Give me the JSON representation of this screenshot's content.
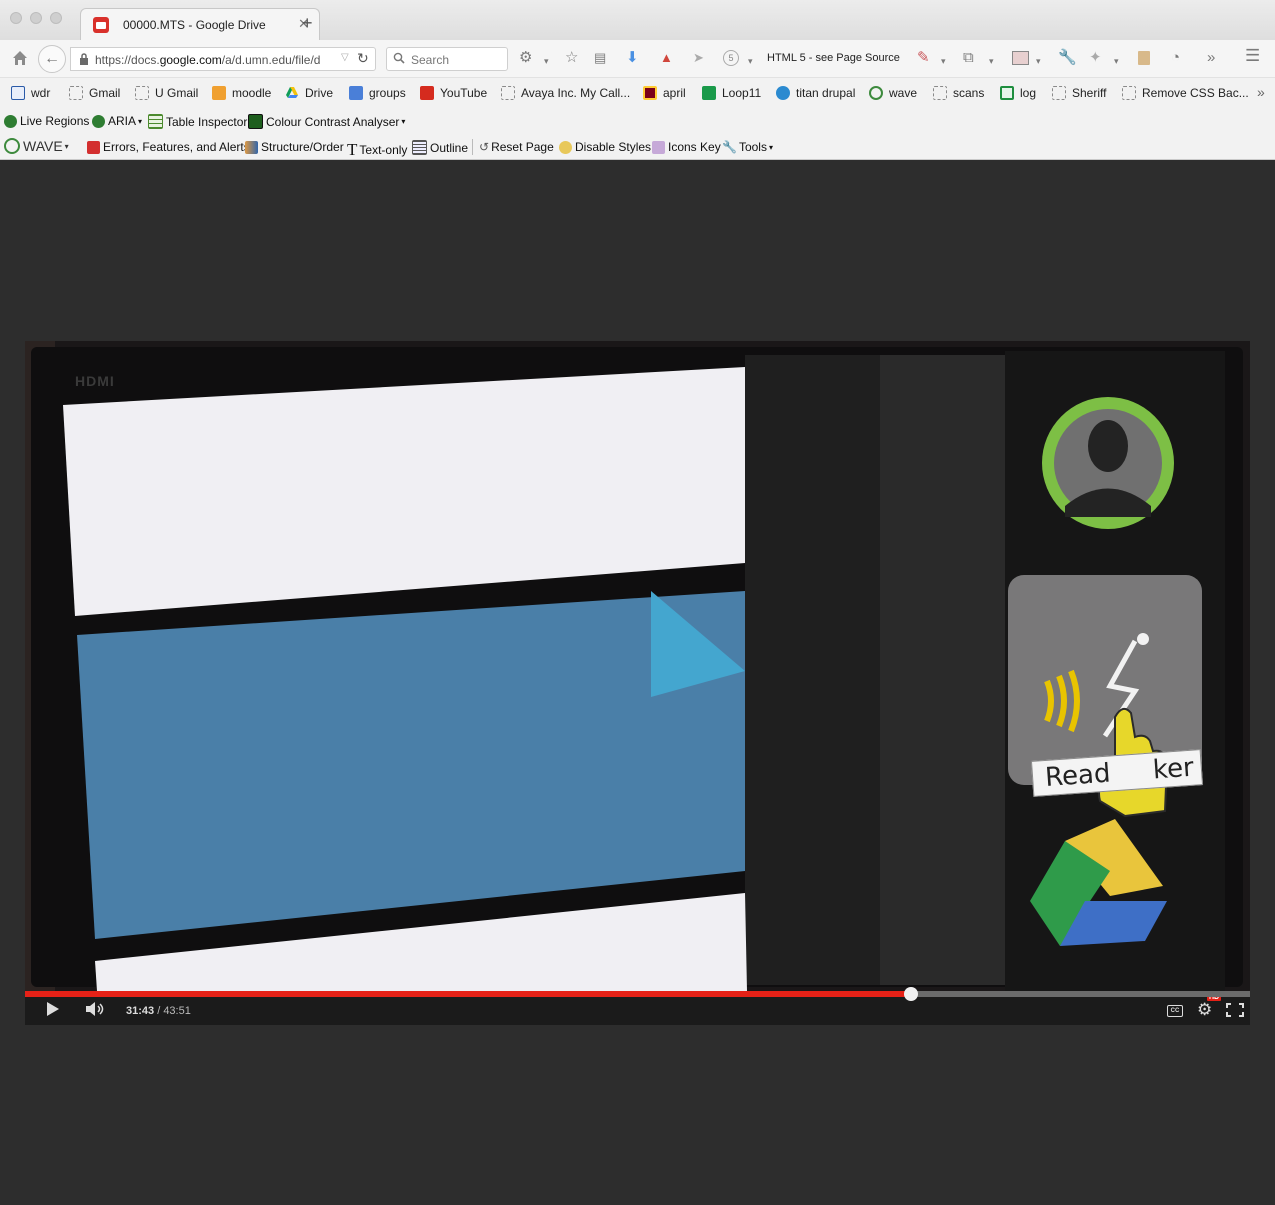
{
  "window": {
    "tab_title": "00000.MTS - Google Drive",
    "tab_close": "✕",
    "new_tab": "+"
  },
  "navbar": {
    "url_prefix": "https://docs.",
    "url_domain": "google.com",
    "url_suffix": "/a/d.umn.edu/file/d",
    "search_placeholder": "Search",
    "badge_count": "5",
    "page_source_label": "HTML 5 - see Page Source"
  },
  "bookmarks": [
    {
      "label": "wdr"
    },
    {
      "label": "Gmail"
    },
    {
      "label": "U Gmail"
    },
    {
      "label": "moodle"
    },
    {
      "label": "Drive"
    },
    {
      "label": "groups"
    },
    {
      "label": "YouTube"
    },
    {
      "label": "Avaya Inc. My Call..."
    },
    {
      "label": "april"
    },
    {
      "label": "Loop11"
    },
    {
      "label": "titan drupal"
    },
    {
      "label": "wave"
    },
    {
      "label": "scans"
    },
    {
      "label": "log"
    },
    {
      "label": "Sheriff"
    },
    {
      "label": "Remove CSS Bac..."
    }
  ],
  "toolbar1": {
    "live_regions": "Live Regions",
    "aria": "ARIA",
    "table_inspector": "Table Inspector",
    "colour_contrast": "Colour Contrast Analyser"
  },
  "toolbar2": {
    "wave": "WAVE",
    "errors": "Errors, Features, and Alerts",
    "structure": "Structure/Order",
    "text_only": "Text-only",
    "outline": "Outline",
    "reset_page": "Reset Page",
    "disable_styles": "Disable Styles",
    "icons_key": "Icons Key",
    "tools": "Tools"
  },
  "video": {
    "hdmi_label": "HDMI",
    "tooltip_text": "Read",
    "tooltip_text_end": "ker"
  },
  "player": {
    "current_time": "31:43",
    "separator": " / ",
    "duration": "43:51",
    "progress_fraction": 0.7233,
    "hd_badge": "HD",
    "accent_color": "#e62117"
  }
}
